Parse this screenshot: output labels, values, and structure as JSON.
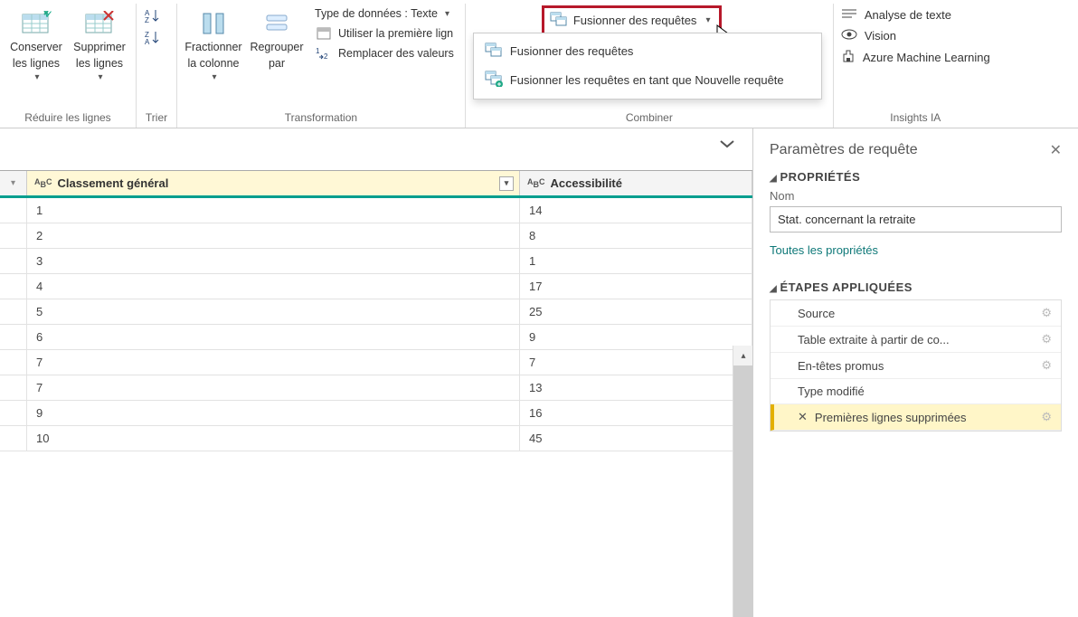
{
  "ribbon": {
    "reduce": {
      "keep": "Conserver\nles lignes",
      "remove": "Supprimer\nles lignes",
      "label": "Réduire les lignes"
    },
    "sort": {
      "label": "Trier"
    },
    "transform": {
      "split": "Fractionner\nla colonne",
      "group": "Regrouper\npar",
      "datatype": "Type de données : Texte",
      "firstrow": "Utiliser la première lign",
      "replace": "Remplacer des valeurs",
      "label": "Transformation"
    },
    "combine": {
      "merge_btn": "Fusionner des requêtes",
      "menu_merge": "Fusionner des requêtes",
      "menu_merge_new": "Fusionner les requêtes en tant que Nouvelle requête",
      "label": "Combiner"
    },
    "insights": {
      "text": "Analyse de texte",
      "vision": "Vision",
      "aml": "Azure Machine Learning",
      "label": "Insights IA"
    }
  },
  "grid": {
    "col1_header": "Classement général",
    "col2_header": "Accessibilité",
    "type_tag": "ABC",
    "rows": [
      {
        "a": "1",
        "b": "14"
      },
      {
        "a": "2",
        "b": "8"
      },
      {
        "a": "3",
        "b": "1"
      },
      {
        "a": "4",
        "b": "17"
      },
      {
        "a": "5",
        "b": "25"
      },
      {
        "a": "6",
        "b": "9"
      },
      {
        "a": "7",
        "b": "7"
      },
      {
        "a": "7",
        "b": "13"
      },
      {
        "a": "9",
        "b": "16"
      },
      {
        "a": "10",
        "b": "45"
      }
    ]
  },
  "settings": {
    "title": "Paramètres de requête",
    "properties": "PROPRIÉTÉS",
    "name_label": "Nom",
    "name_value": "Stat. concernant la retraite",
    "all_props": "Toutes les propriétés",
    "steps_label": "ÉTAPES APPLIQUÉES",
    "steps": [
      "Source",
      "Table extraite à partir de co...",
      "En-têtes promus",
      "Type modifié",
      "Premières lignes supprimées"
    ]
  }
}
